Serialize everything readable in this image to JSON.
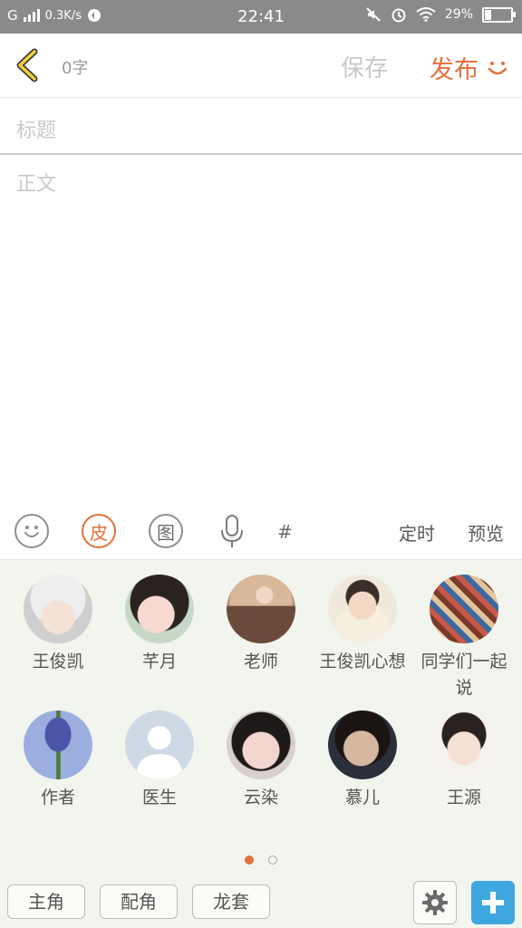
{
  "status_bar": {
    "network_speed": "0.3K/s",
    "carrier_icon": "G",
    "time": "22:41",
    "battery": "29%"
  },
  "header": {
    "word_count": "0字",
    "save_label": "保存",
    "publish_label": "发布"
  },
  "editor": {
    "title_placeholder": "标题",
    "body_placeholder": "正文"
  },
  "toolbar": {
    "skin_label": "皮",
    "image_label": "图",
    "hash_label": "#",
    "schedule_label": "定时",
    "preview_label": "预览"
  },
  "characters": [
    {
      "name": "王俊凯"
    },
    {
      "name": "芊月"
    },
    {
      "name": "老师"
    },
    {
      "name": "王俊凯心想"
    },
    {
      "name": "同学们一起说"
    },
    {
      "name": "作者"
    },
    {
      "name": "医生"
    },
    {
      "name": "云染"
    },
    {
      "name": "慕儿"
    },
    {
      "name": "王源"
    }
  ],
  "bottom_bar": {
    "lead_label": "主角",
    "support_label": "配角",
    "extra_label": "龙套"
  },
  "colors": {
    "accent": "#e2703a",
    "plus": "#3fa7e0"
  }
}
